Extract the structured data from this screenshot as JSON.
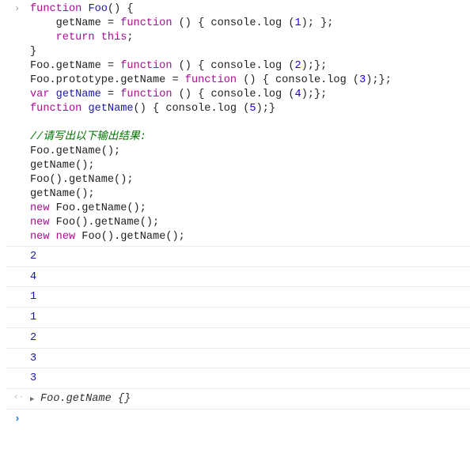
{
  "input": {
    "lines": [
      [
        {
          "t": "kw",
          "v": "function"
        },
        {
          "t": "plain",
          "v": " "
        },
        {
          "t": "fnname",
          "v": "Foo"
        },
        {
          "t": "plain",
          "v": "() {"
        }
      ],
      [
        {
          "t": "plain",
          "v": "    getName = "
        },
        {
          "t": "kw",
          "v": "function"
        },
        {
          "t": "plain",
          "v": " () { console.log ("
        },
        {
          "t": "num",
          "v": "1"
        },
        {
          "t": "plain",
          "v": "); };"
        }
      ],
      [
        {
          "t": "plain",
          "v": "    "
        },
        {
          "t": "kw",
          "v": "return"
        },
        {
          "t": "plain",
          "v": " "
        },
        {
          "t": "kw",
          "v": "this"
        },
        {
          "t": "plain",
          "v": ";"
        }
      ],
      [
        {
          "t": "plain",
          "v": "}"
        }
      ],
      [
        {
          "t": "plain",
          "v": "Foo.getName = "
        },
        {
          "t": "kw",
          "v": "function"
        },
        {
          "t": "plain",
          "v": " () { console.log ("
        },
        {
          "t": "num",
          "v": "2"
        },
        {
          "t": "plain",
          "v": ");};"
        }
      ],
      [
        {
          "t": "plain",
          "v": "Foo.prototype.getName = "
        },
        {
          "t": "kw",
          "v": "function"
        },
        {
          "t": "plain",
          "v": " () { console.log ("
        },
        {
          "t": "num",
          "v": "3"
        },
        {
          "t": "plain",
          "v": ");};"
        }
      ],
      [
        {
          "t": "kw",
          "v": "var"
        },
        {
          "t": "plain",
          "v": " "
        },
        {
          "t": "fnname",
          "v": "getName"
        },
        {
          "t": "plain",
          "v": " = "
        },
        {
          "t": "kw",
          "v": "function"
        },
        {
          "t": "plain",
          "v": " () { console.log ("
        },
        {
          "t": "num",
          "v": "4"
        },
        {
          "t": "plain",
          "v": ");};"
        }
      ],
      [
        {
          "t": "kw",
          "v": "function"
        },
        {
          "t": "plain",
          "v": " "
        },
        {
          "t": "fnname",
          "v": "getName"
        },
        {
          "t": "plain",
          "v": "() { console.log ("
        },
        {
          "t": "num",
          "v": "5"
        },
        {
          "t": "plain",
          "v": ");}"
        }
      ],
      [
        {
          "t": "plain",
          "v": ""
        }
      ],
      [
        {
          "t": "cmt",
          "v": "//请写出以下输出结果:"
        }
      ],
      [
        {
          "t": "plain",
          "v": "Foo.getName();"
        }
      ],
      [
        {
          "t": "plain",
          "v": "getName();"
        }
      ],
      [
        {
          "t": "plain",
          "v": "Foo().getName();"
        }
      ],
      [
        {
          "t": "plain",
          "v": "getName();"
        }
      ],
      [
        {
          "t": "kw",
          "v": "new"
        },
        {
          "t": "plain",
          "v": " Foo.getName();"
        }
      ],
      [
        {
          "t": "kw",
          "v": "new"
        },
        {
          "t": "plain",
          "v": " Foo().getName();"
        }
      ],
      [
        {
          "t": "kw",
          "v": "new"
        },
        {
          "t": "plain",
          "v": " "
        },
        {
          "t": "kw",
          "v": "new"
        },
        {
          "t": "plain",
          "v": " Foo().getName();"
        }
      ]
    ]
  },
  "outputs": [
    "2",
    "4",
    "1",
    "1",
    "2",
    "3",
    "3"
  ],
  "result": {
    "text": "Foo.getName {}",
    "arrow_icon": "result-arrow-icon",
    "expand_icon": "expand-triangle-icon"
  },
  "prompt": {
    "icon": "prompt-chevron-icon"
  },
  "colors": {
    "keyword": "#aa0d91",
    "number": "#1c00cf",
    "function_name": "#1a1aa6",
    "comment": "#007400",
    "output_value": "#1a1aa6",
    "prompt_active": "#1a73e8"
  }
}
